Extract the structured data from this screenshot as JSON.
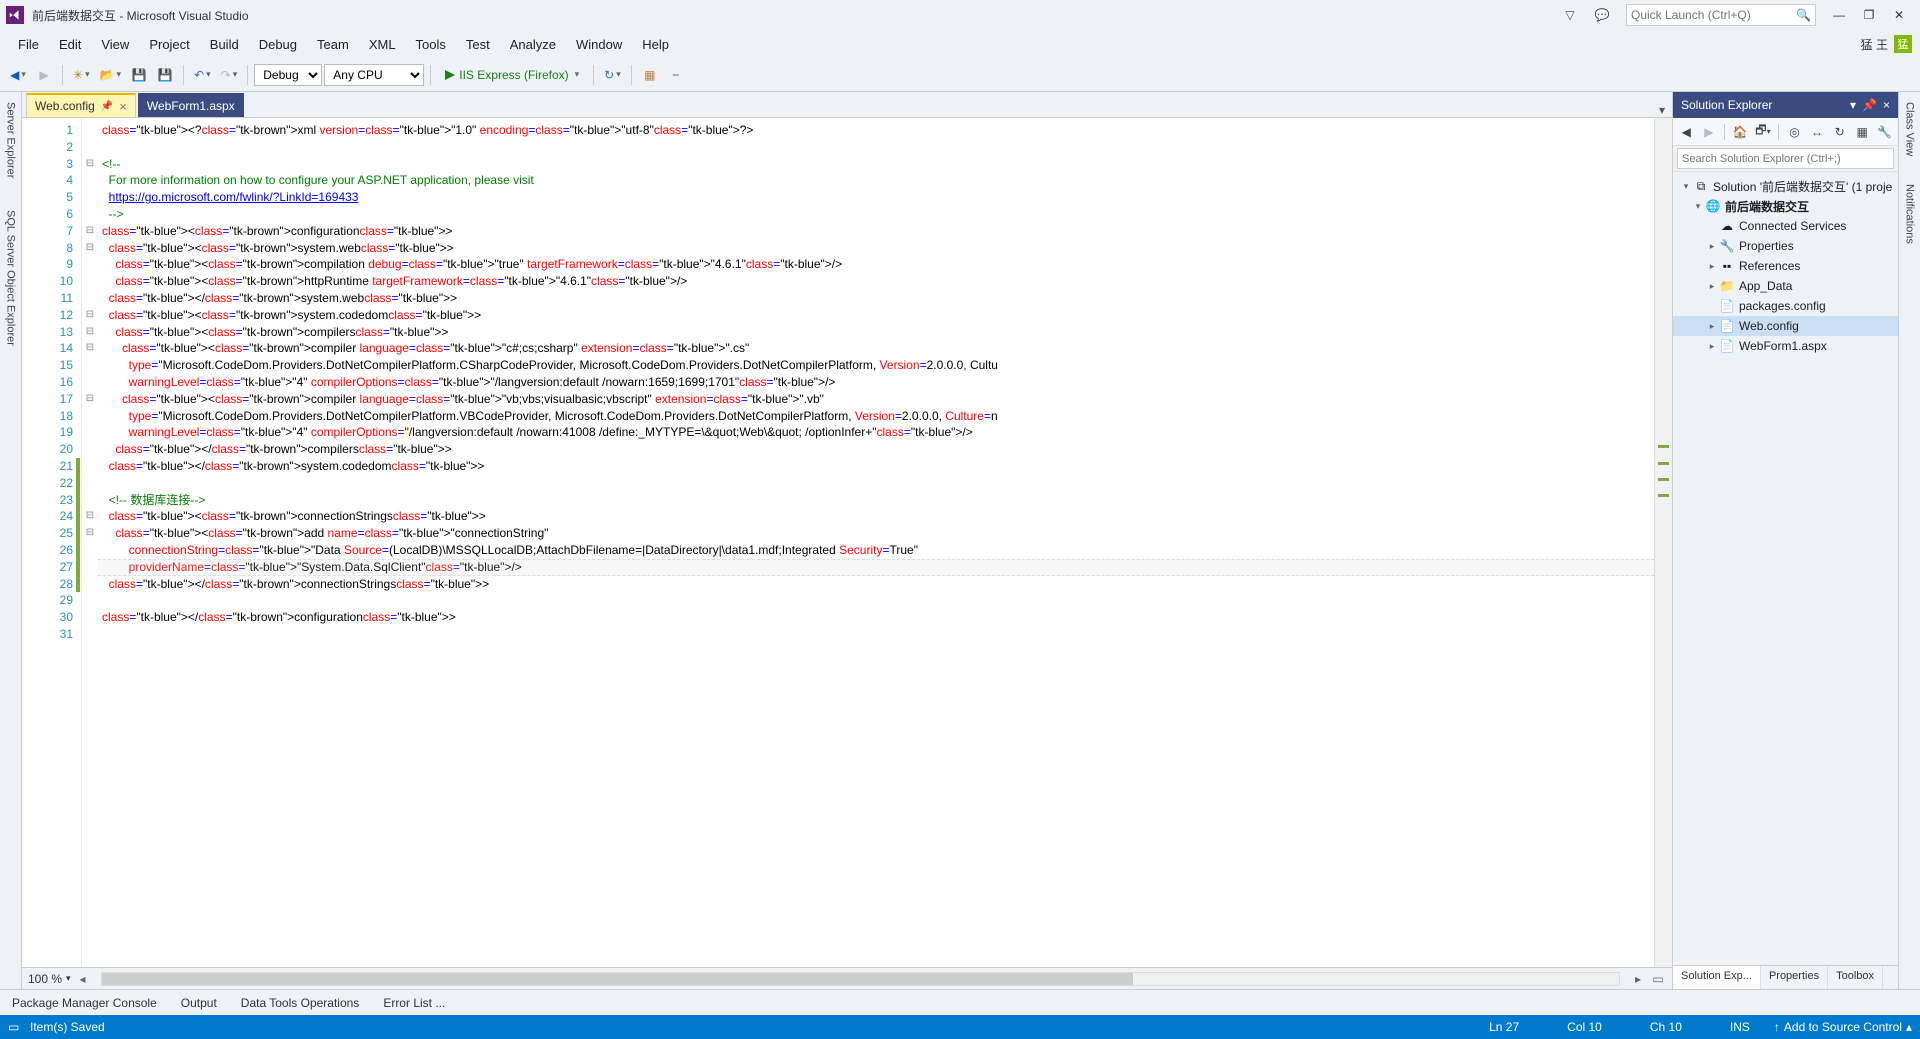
{
  "title": "前后端数据交互 - Microsoft Visual Studio",
  "quicklaunch": {
    "placeholder": "Quick Launch (Ctrl+Q)"
  },
  "menus": [
    "File",
    "Edit",
    "View",
    "Project",
    "Build",
    "Debug",
    "Team",
    "XML",
    "Tools",
    "Test",
    "Analyze",
    "Window",
    "Help"
  ],
  "user": {
    "name": "猛 王",
    "badge": "猛"
  },
  "toolbar": {
    "config": "Debug",
    "platform": "Any CPU",
    "run_label": "IIS Express (Firefox)"
  },
  "tabs": [
    {
      "label": "Web.config",
      "active": true,
      "pinned": true
    },
    {
      "label": "WebForm1.aspx",
      "active": false,
      "pinned": false
    }
  ],
  "left_rail": [
    "Server Explorer",
    "SQL Server Object Explorer"
  ],
  "right_rail": [
    "Class View",
    "Notifications"
  ],
  "zoom": "100 %",
  "output_tabs": [
    "Package Manager Console",
    "Output",
    "Data Tools Operations",
    "Error List ..."
  ],
  "status": {
    "message": "Item(s) Saved",
    "line": "Ln 27",
    "col": "Col 10",
    "ch": "Ch 10",
    "ins": "INS",
    "source_control": "Add to Source Control"
  },
  "solution_explorer": {
    "title": "Solution Explorer",
    "search_placeholder": "Search Solution Explorer (Ctrl+;)",
    "solution_label": "Solution '前后端数据交互' (1 proje",
    "project_label": "前后端数据交互",
    "nodes": {
      "connected_services": "Connected Services",
      "properties": "Properties",
      "references": "References",
      "app_data": "App_Data",
      "packages": "packages.config",
      "webconfig": "Web.config",
      "webform": "WebForm1.aspx"
    },
    "panel_tabs": [
      "Solution Exp...",
      "Properties",
      "Toolbox"
    ]
  },
  "code": {
    "line_count": 31,
    "current_line": 27,
    "modified_lines": [
      21,
      22,
      23,
      24,
      25,
      26,
      27,
      28
    ],
    "lines": {
      "1": "<?xml version=\"1.0\" encoding=\"utf-8\"?>",
      "2": "",
      "3": "<!--",
      "4": "  For more information on how to configure your ASP.NET application, please visit",
      "5": "  https://go.microsoft.com/fwlink/?LinkId=169433",
      "6": "  -->",
      "7": "<configuration>",
      "8": "  <system.web>",
      "9": "    <compilation debug=\"true\" targetFramework=\"4.6.1\"/>",
      "10": "    <httpRuntime targetFramework=\"4.6.1\"/>",
      "11": "  </system.web>",
      "12": "  <system.codedom>",
      "13": "    <compilers>",
      "14": "      <compiler language=\"c#;cs;csharp\" extension=\".cs\"",
      "15": "        type=\"Microsoft.CodeDom.Providers.DotNetCompilerPlatform.CSharpCodeProvider, Microsoft.CodeDom.Providers.DotNetCompilerPlatform, Version=2.0.0.0, Cultu",
      "16": "        warningLevel=\"4\" compilerOptions=\"/langversion:default /nowarn:1659;1699;1701\"/>",
      "17": "      <compiler language=\"vb;vbs;visualbasic;vbscript\" extension=\".vb\"",
      "18": "        type=\"Microsoft.CodeDom.Providers.DotNetCompilerPlatform.VBCodeProvider, Microsoft.CodeDom.Providers.DotNetCompilerPlatform, Version=2.0.0.0, Culture=n",
      "19": "        warningLevel=\"4\" compilerOptions=\"/langversion:default /nowarn:41008 /define:_MYTYPE=\\&quot;Web\\&quot; /optionInfer+\"/>",
      "20": "    </compilers>",
      "21": "  </system.codedom>",
      "22": "",
      "23": "  <!-- 数据库连接-->",
      "24": "  <connectionStrings>",
      "25": "    <add name=\"connectionString\"",
      "26": "        connectionString=\"Data Source=(LocalDB)\\MSSQLLocalDB;AttachDbFilename=|DataDirectory|\\data1.mdf;Integrated Security=True\"",
      "27": "        providerName=\"System.Data.SqlClient\"/>",
      "28": "  </connectionStrings>",
      "29": "",
      "30": "</configuration>",
      "31": ""
    }
  }
}
